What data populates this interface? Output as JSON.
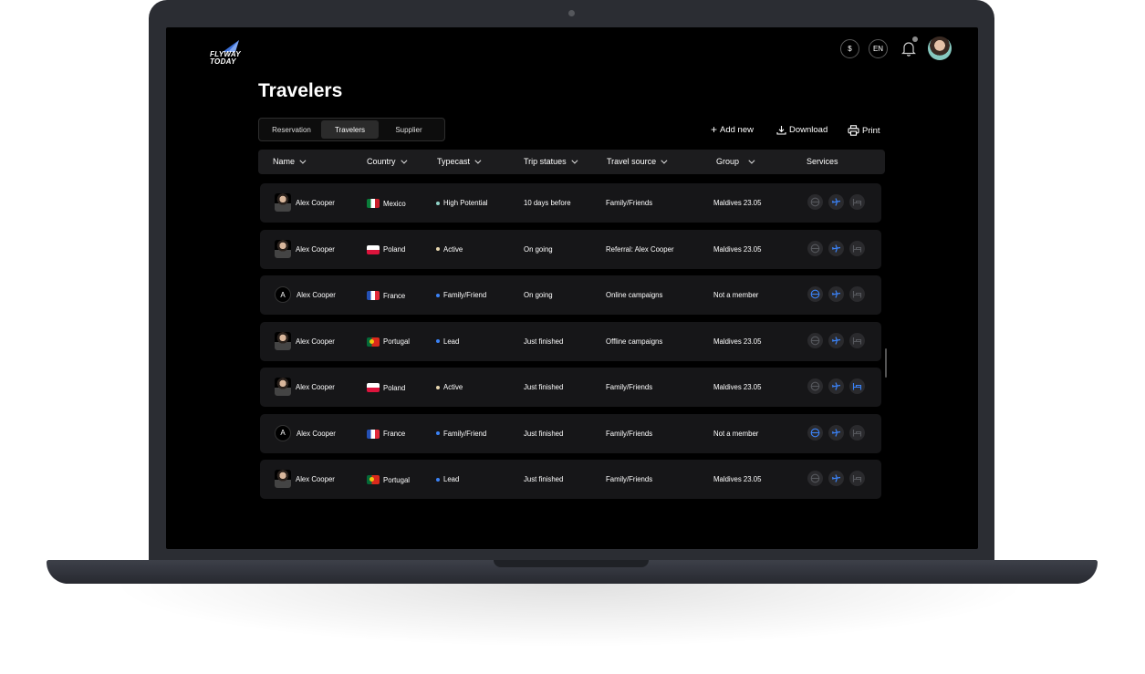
{
  "header": {
    "logo_line1": "FLYWAY",
    "logo_line2": "TODAY",
    "currency": "$",
    "language": "EN"
  },
  "page": {
    "title": "Travelers"
  },
  "tabs": [
    {
      "label": "Reservation",
      "active": false
    },
    {
      "label": "Travelers",
      "active": true
    },
    {
      "label": "Supplier",
      "active": false
    }
  ],
  "actions": {
    "add_new": "Add new",
    "download": "Download",
    "print": "Print"
  },
  "table": {
    "columns": [
      "Name",
      "Country",
      "Typecast",
      "Trip statues",
      "Travel source",
      "Group",
      "Services"
    ],
    "rows": [
      {
        "avatar": "photo",
        "name": "Alex Cooper",
        "country": "Mexico",
        "flag": "mx",
        "typecast": "High Potential",
        "dot": "#8fd3c8",
        "trip": "10 days before",
        "source": "Family/Friends",
        "group": "Maldives 23.05",
        "services": [
          false,
          true,
          false
        ]
      },
      {
        "avatar": "photo",
        "name": "Alex Cooper",
        "country": "Poland",
        "flag": "pl",
        "typecast": "Active",
        "dot": "#e8d7b0",
        "trip": "On going",
        "source": "Referral: Alex Cooper",
        "group": "Maldives 23.05",
        "services": [
          false,
          true,
          false
        ]
      },
      {
        "avatar": "initial",
        "initial": "A",
        "name": "Alex Cooper",
        "country": "France",
        "flag": "fr",
        "typecast": "Family/Friend",
        "dot": "#3b82f6",
        "trip": "On going",
        "source": "Online campaigns",
        "group": "Not a member",
        "services": [
          true,
          true,
          false
        ]
      },
      {
        "avatar": "photo",
        "name": "Alex Cooper",
        "country": "Portugal",
        "flag": "pt",
        "typecast": "Lead",
        "dot": "#3b82f6",
        "trip": "Just finished",
        "source": "Offline campaigns",
        "group": "Maldives 23.05",
        "services": [
          false,
          true,
          false
        ]
      },
      {
        "avatar": "photo",
        "name": "Alex Cooper",
        "country": "Poland",
        "flag": "pl",
        "typecast": "Active",
        "dot": "#e8d7b0",
        "trip": "Just finished",
        "source": "Family/Friends",
        "group": "Maldives 23.05",
        "services": [
          false,
          true,
          true
        ]
      },
      {
        "avatar": "initial",
        "initial": "A",
        "name": "Alex Cooper",
        "country": "France",
        "flag": "fr",
        "typecast": "Family/Friend",
        "dot": "#3b82f6",
        "trip": "Just finished",
        "source": "Family/Friends",
        "group": "Not a member",
        "services": [
          true,
          true,
          false
        ]
      },
      {
        "avatar": "photo",
        "name": "Alex Cooper",
        "country": "Portugal",
        "flag": "pt",
        "typecast": "Lead",
        "dot": "#3b82f6",
        "trip": "Just finished",
        "source": "Family/Friends",
        "group": "Maldives 23.05",
        "services": [
          false,
          true,
          false
        ]
      }
    ]
  },
  "colors": {
    "accent": "#3b82f6",
    "inactive_icon": "#55575c"
  }
}
